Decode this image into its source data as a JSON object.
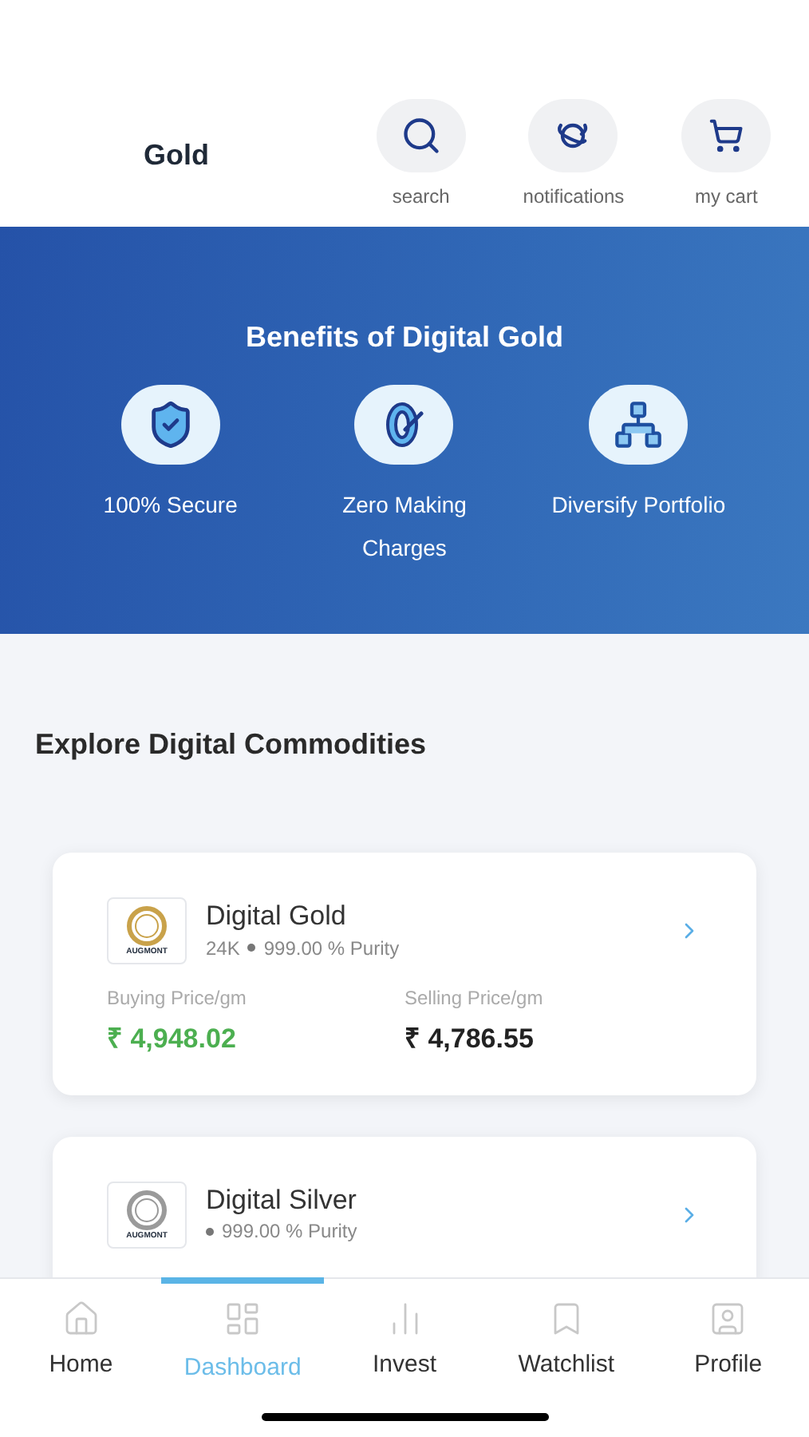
{
  "header": {
    "title": "Gold",
    "actions": [
      {
        "label": "search"
      },
      {
        "label": "notifications"
      },
      {
        "label": "my cart"
      }
    ]
  },
  "benefits": {
    "title": "Benefits of Digital Gold",
    "items": [
      {
        "label": "100% Secure"
      },
      {
        "label": "Zero Making Charges"
      },
      {
        "label": "Diversify Portfolio"
      }
    ]
  },
  "commodities": {
    "title": "Explore Digital Commodities",
    "cards": [
      {
        "logo_text": "AUGMONT",
        "color": "#c9a24a",
        "name": "Digital Gold",
        "karat": "24K",
        "purity": "999.00 % Purity",
        "buy_label": "Buying Price/gm",
        "buy_price": "₹ 4,948.02",
        "sell_label": "Selling Price/gm",
        "sell_price": "₹ 4,786.55"
      },
      {
        "logo_text": "AUGMONT",
        "color": "#9a9a9a",
        "name": "Digital Silver",
        "purity": "999.00 % Purity"
      }
    ]
  },
  "nav": [
    {
      "label": "Home",
      "selected": false
    },
    {
      "label": "Dashboard",
      "selected": true
    },
    {
      "label": "Invest",
      "selected": false
    },
    {
      "label": "Watchlist",
      "selected": false
    },
    {
      "label": "Profile",
      "selected": false
    }
  ]
}
